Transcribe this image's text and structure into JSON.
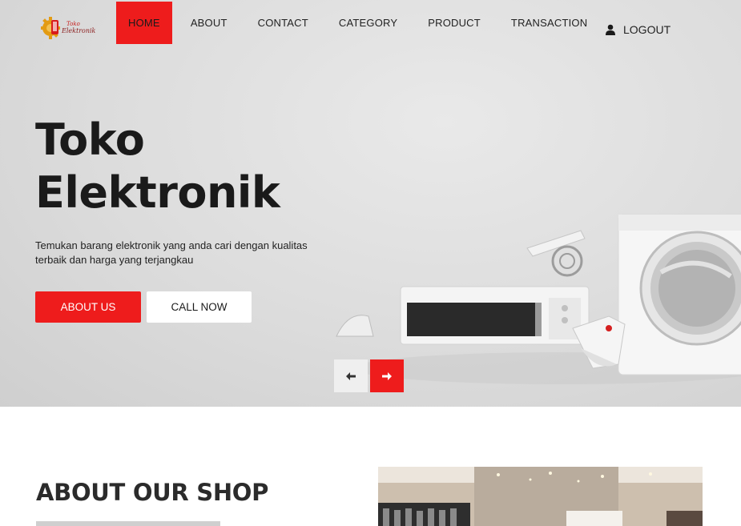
{
  "header": {
    "logo_text_line1": "Toko",
    "logo_text_line2": "Elektronik",
    "nav": [
      {
        "label": "HOME",
        "active": true
      },
      {
        "label": "ABOUT",
        "active": false
      },
      {
        "label": "CONTACT",
        "active": false
      },
      {
        "label": "CATEGORY",
        "active": false
      },
      {
        "label": "PRODUCT",
        "active": false
      },
      {
        "label": "TRANSACTION",
        "active": false
      }
    ],
    "logout_label": "LOGOUT",
    "logout_icon": "user-icon"
  },
  "hero": {
    "title_line1": "Toko",
    "title_line2": "Elektronik",
    "description": "Temukan barang elektronik yang anda cari dengan kualitas terbaik dan harga yang terjangkau",
    "primary_button": "ABOUT US",
    "secondary_button": "CALL NOW",
    "prev_icon": "arrow-left-icon",
    "next_icon": "arrow-right-icon"
  },
  "about": {
    "title": "ABOUT OUR SHOP"
  },
  "colors": {
    "accent": "#ee1c1c",
    "text_dark": "#1a1a1a",
    "hero_bg": "#dcdcdc"
  }
}
